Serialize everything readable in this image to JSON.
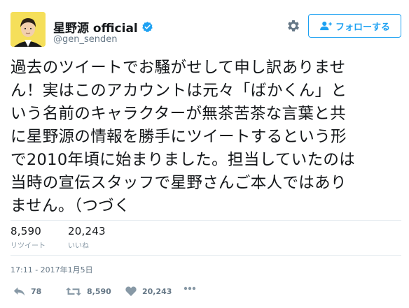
{
  "user": {
    "display_name": "星野源 official",
    "handle": "@gen_senden"
  },
  "header": {
    "follow_label": "フォローする"
  },
  "tweet": {
    "lines": [
      "過去のツイートでお騒がせして申し訳ありませ",
      "ん！実はこのアカウントは元々「ばかくん」と",
      "いう名前のキャラクターが無茶苦茶な言葉と共",
      "に星野源の情報を勝手にツイートするという形",
      "で2010年頃に始まりました。担当していたのは",
      "当時の宣伝スタッフで星野さんご本人ではあり",
      "ません。（つづく"
    ]
  },
  "stats": {
    "retweets_value": "8,590",
    "retweets_label": "リツイート",
    "likes_value": "20,243",
    "likes_label": "いいね"
  },
  "timestamp": "17:11 - 2017年1月5日",
  "actions": {
    "reply_count": "78",
    "retweet_count": "8,590",
    "like_count": "20,243"
  },
  "colors": {
    "accent": "#1da1f2",
    "muted_text": "#657786",
    "divider": "#e6ecf0"
  }
}
